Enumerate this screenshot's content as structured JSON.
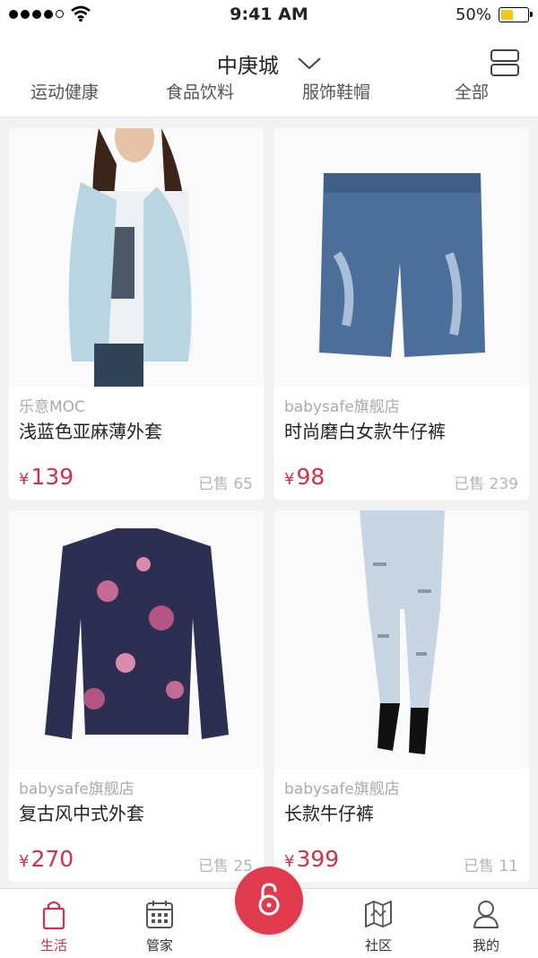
{
  "status": {
    "time": "9:41 AM",
    "battery": "50%",
    "battery_level": 0.5
  },
  "nav": {
    "title": "中庚城"
  },
  "categories": [
    "运动健康",
    "食品饮料",
    "服饰鞋帽",
    "全部"
  ],
  "products": [
    {
      "shop": "乐意MOC",
      "name": "浅蓝色亚麻薄外套",
      "currency": "¥",
      "price": "139",
      "sold": "已售 65"
    },
    {
      "shop": "babysafe旗舰店",
      "name": "时尚磨白女款牛仔裤",
      "currency": "¥",
      "price": "98",
      "sold": "已售 239"
    },
    {
      "shop": "babysafe旗舰店",
      "name": "复古风中式外套",
      "currency": "¥",
      "price": "270",
      "sold": "已售 25"
    },
    {
      "shop": "babysafe旗舰店",
      "name": "长款牛仔裤",
      "currency": "¥",
      "price": "399",
      "sold": "已售 11"
    }
  ],
  "tabs": [
    {
      "label": "生活",
      "icon": "shopping-bag-icon",
      "active": true
    },
    {
      "label": "管家",
      "icon": "calendar-icon",
      "active": false
    },
    {
      "label": "",
      "icon": "unlock-icon",
      "active": false
    },
    {
      "label": "社区",
      "icon": "map-icon",
      "active": false
    },
    {
      "label": "我的",
      "icon": "user-icon",
      "active": false
    }
  ],
  "colors": {
    "accent": "#d7304a",
    "background": "#f2f2f2"
  }
}
